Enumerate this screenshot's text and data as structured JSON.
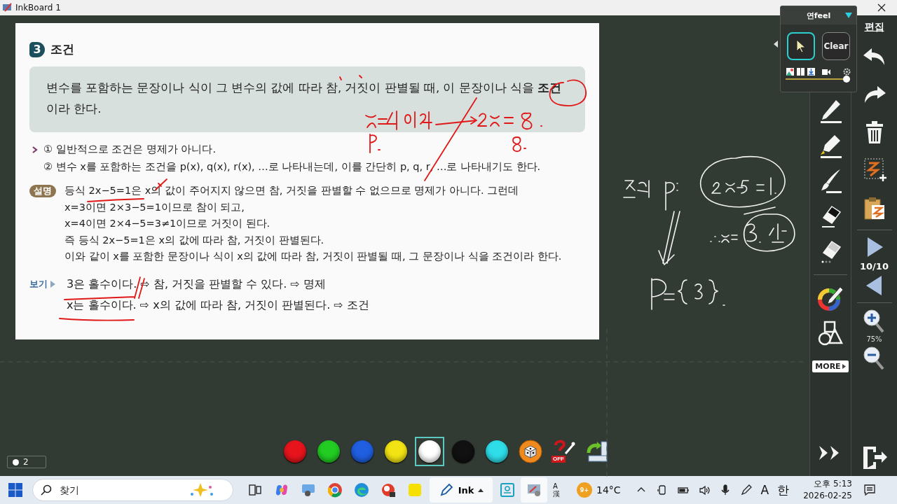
{
  "window": {
    "title": "InkBoard 1"
  },
  "document": {
    "section_number": "3",
    "section_title": "조건",
    "definition": "변수를 포함하는 문장이나 식이 그 변수의 값에 따라 참, 거짓이 판별될 때, 이 문장이나 식을 **조건**이라 한다.",
    "notes": [
      "① 일반적으로 조건은 명제가 아니다.",
      "② 변수 x를 포함하는 조건을 p(x), q(x), r(x), …로 나타내는데, 이를 간단히 p, q, r, …로 나타내기도 한다."
    ],
    "explanation": {
      "badge": "설명",
      "lines": [
        "등식 2x−5=1은 x의 값이 주어지지 않으면 참, 거짓을 판별할 수 없으므로 명제가 아니다. 그런데",
        "x=3이면 2×3−5=1이므로 참이 되고,",
        "x=4이면 2×4−5=3≠1이므로 거짓이 된다.",
        "즉 등식 2x−5=1은 x의 값에 따라 참, 거짓이 판별된다.",
        "이와 같이 x를 포함한 문장이나 식이 x의 값에 따라 참, 거짓이 판별될 때, 그 문장이나 식을 조건이라 한다."
      ]
    },
    "example": {
      "label": "보기",
      "lines": [
        "3은 홀수이다. ⇨ 참, 거짓을 판별할 수 있다. ⇨ 명제",
        "x는 홀수이다. ⇨ x의 값에 따라 참, 거짓이 판별된다. ⇨ 조건"
      ]
    }
  },
  "float_panel": {
    "title": "연feel",
    "buttons": [
      {
        "kind": "pointer",
        "selected": true
      },
      {
        "kind": "text",
        "label": "Clear",
        "selected": false
      }
    ],
    "level": 1
  },
  "tool_rail": {
    "more": "MORE"
  },
  "edit_rail": {
    "title": "편집",
    "page": "10/10",
    "zoom": "75%"
  },
  "palette": [
    {
      "kind": "color",
      "color": "#e8141c",
      "selected": false
    },
    {
      "kind": "color",
      "color": "#22cc22",
      "selected": false
    },
    {
      "kind": "color",
      "color": "#1f5fe0",
      "selected": false
    },
    {
      "kind": "color",
      "color": "#f2e414",
      "selected": false
    },
    {
      "kind": "color",
      "color": "#ffffff",
      "selected": true
    },
    {
      "kind": "color",
      "color": "#111111",
      "selected": false
    },
    {
      "kind": "color",
      "color": "#2edde8",
      "selected": false
    },
    {
      "kind": "dice",
      "selected": false
    },
    {
      "kind": "off",
      "label": "OFF",
      "selected": false
    },
    {
      "kind": "ruler",
      "selected": false
    }
  ],
  "page_indicator": "2",
  "taskbar": {
    "search_placeholder": "찾기",
    "apps": [
      {
        "kind": "taskview",
        "active": false
      },
      {
        "kind": "copilot",
        "active": false
      },
      {
        "kind": "chat",
        "active": false
      },
      {
        "kind": "chrome",
        "active": false
      },
      {
        "kind": "edge",
        "active": false
      },
      {
        "kind": "photo",
        "active": false
      },
      {
        "kind": "kakao",
        "active": false
      },
      {
        "kind": "ink",
        "label": "Ink",
        "active": true
      },
      {
        "kind": "notes",
        "active": false
      },
      {
        "kind": "board",
        "active": true
      }
    ],
    "ime": [
      "A",
      "漢"
    ],
    "weather_badge": "9+",
    "temperature": "14°C",
    "font_key": "A",
    "language": "한",
    "time": "오후 5:13",
    "date": "2026-02-25"
  }
}
